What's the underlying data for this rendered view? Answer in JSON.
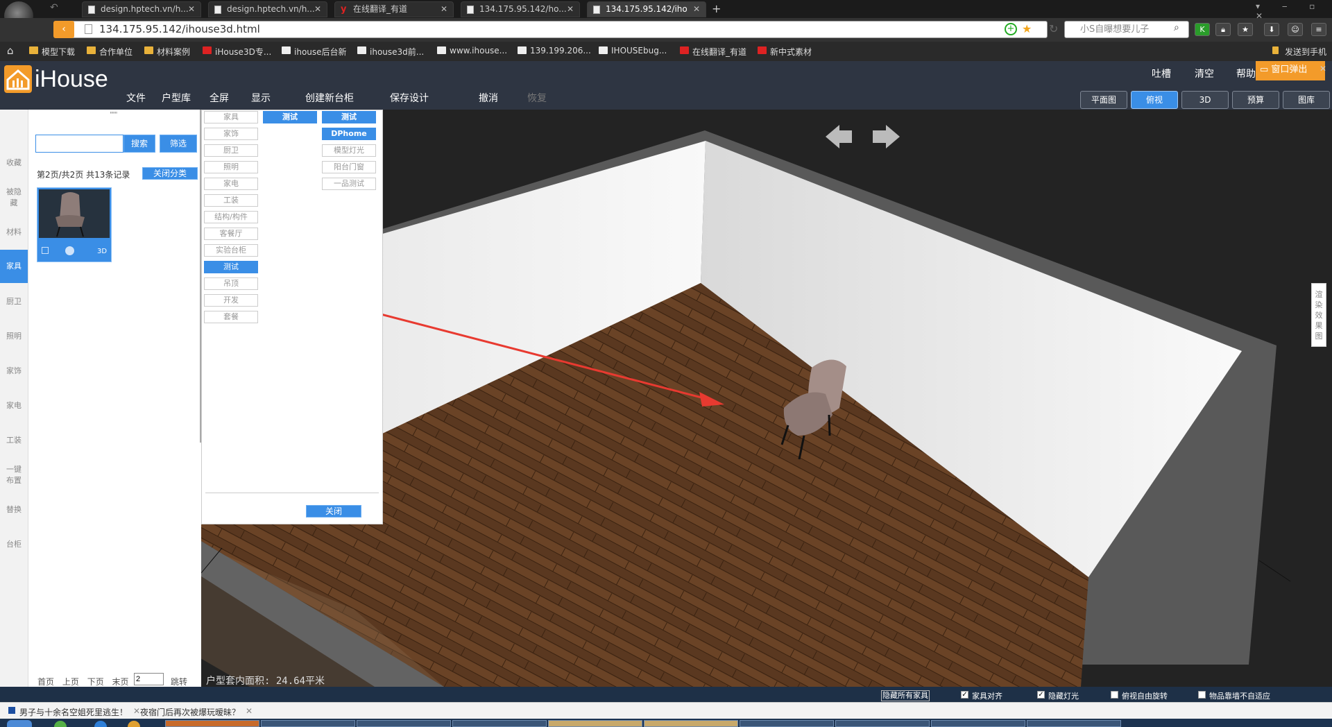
{
  "browser": {
    "tabs": [
      {
        "label": "design.hptech.vn/h..."
      },
      {
        "label": "design.hptech.vn/h..."
      },
      {
        "label": "在线翻译_有道"
      },
      {
        "label": "134.175.95.142/ho..."
      },
      {
        "label": "134.175.95.142/iho"
      }
    ],
    "new_tab": "+",
    "url": "134.175.95.142/ihouse3d.html",
    "search_placeholder": "小S自曝想要儿子",
    "toolbar_icons": [
      "refresh-icon",
      "star-icon",
      "lock-icon",
      "download-icon",
      "game-icon",
      "menu-icon"
    ],
    "bookmarks": [
      {
        "label": "模型下载",
        "icon": "folder"
      },
      {
        "label": "合作单位",
        "icon": "folder"
      },
      {
        "label": "材料案例",
        "icon": "folder"
      },
      {
        "label": "iHouse3D专...",
        "icon": "site"
      },
      {
        "label": "ihouse后台新",
        "icon": "page"
      },
      {
        "label": "ihouse3d前...",
        "icon": "page"
      },
      {
        "label": "www.ihouse...",
        "icon": "page"
      },
      {
        "label": "139.199.206...",
        "icon": "page"
      },
      {
        "label": "IHOUSEbug...",
        "icon": "site"
      },
      {
        "label": "在线翻译_有道",
        "icon": "youdao"
      },
      {
        "label": "新中式素材",
        "icon": "red"
      }
    ],
    "send_to_phone": "发送到手机"
  },
  "app": {
    "logo": "iHouse",
    "menu": [
      {
        "label": "文件",
        "disabled": false
      },
      {
        "label": "户型库",
        "disabled": false
      },
      {
        "label": "全屏",
        "disabled": false
      },
      {
        "label": "显示",
        "disabled": false
      },
      {
        "label": "创建新台柜",
        "disabled": false
      },
      {
        "label": "保存设计",
        "disabled": false
      },
      {
        "label": "撤消",
        "disabled": false
      },
      {
        "label": "恢复",
        "disabled": true
      }
    ],
    "top_right": {
      "feedback": "吐槽",
      "clear": "清空",
      "help": "帮助",
      "popup": "窗口弹出"
    },
    "views": [
      {
        "label": "平面图",
        "active": false
      },
      {
        "label": "俯视",
        "active": true
      },
      {
        "label": "3D",
        "active": false
      },
      {
        "label": "预算",
        "active": false
      },
      {
        "label": "图库",
        "active": false
      }
    ]
  },
  "sidebar": {
    "items": [
      {
        "label": "收藏",
        "active": false
      },
      {
        "label": "被隐藏",
        "active": false
      },
      {
        "label": "材料",
        "active": false
      },
      {
        "label": "家具",
        "active": true
      },
      {
        "label": "厨卫",
        "active": false
      },
      {
        "label": "照明",
        "active": false
      },
      {
        "label": "家饰",
        "active": false
      },
      {
        "label": "家电",
        "active": false
      },
      {
        "label": "工装",
        "active": false
      },
      {
        "label": "一键布置",
        "active": false
      },
      {
        "label": "替换",
        "active": false
      },
      {
        "label": "台柜",
        "active": false
      }
    ]
  },
  "panel": {
    "drag_handle": "''''''",
    "search_value": "",
    "search_button": "搜索",
    "filter_button": "筛选",
    "page_info": "第2页/共2页 共13条记录",
    "close_category": "关闭分类",
    "item": {
      "badge": "3D"
    },
    "pager": {
      "first": "首页",
      "prev": "上页",
      "next": "下页",
      "last": "末页",
      "page": "2",
      "go": "跳转"
    }
  },
  "categories": {
    "main": [
      {
        "label": "家具",
        "active": false
      },
      {
        "label": "家饰",
        "active": false
      },
      {
        "label": "厨卫",
        "active": false
      },
      {
        "label": "照明",
        "active": false
      },
      {
        "label": "家电",
        "active": false
      },
      {
        "label": "工装",
        "active": false
      },
      {
        "label": "结构/构件",
        "active": false
      },
      {
        "label": "客餐厅",
        "active": false
      },
      {
        "label": "实验台柜",
        "active": false
      },
      {
        "label": "测试",
        "active": true
      },
      {
        "label": "吊顶",
        "active": false
      },
      {
        "label": "开发",
        "active": false
      },
      {
        "label": "套餐",
        "active": false
      }
    ],
    "sub_a": [
      {
        "label": "测试",
        "active": true
      }
    ],
    "sub_b": [
      {
        "label": "测试",
        "active": true
      },
      {
        "label": "DPhome",
        "active": true
      },
      {
        "label": "模型灯光",
        "active": false
      },
      {
        "label": "阳台门窗",
        "active": false
      },
      {
        "label": "一品测试",
        "active": false
      }
    ],
    "close_button": "关闭"
  },
  "viewport": {
    "area_text": "户型套内面积: 24.64平米",
    "render_tab": "渲染效果图"
  },
  "bottom": {
    "hide_all": "隐藏所有家具",
    "options": [
      {
        "label": "家具对齐",
        "checked": true
      },
      {
        "label": "隐藏灯光",
        "checked": true
      },
      {
        "label": "俯视自由旋转",
        "checked": false
      },
      {
        "label": "物品靠墙不自适应",
        "checked": false
      }
    ]
  },
  "news": [
    {
      "label": "男子与十余名空姐死里逃生！"
    },
    {
      "label": "夜宿门后再次被爆玩暧昧？"
    }
  ],
  "colors": {
    "accent": "#3a8ee6",
    "brand": "#f39b2a",
    "header": "#2e3542",
    "floor": "#5a3820"
  }
}
